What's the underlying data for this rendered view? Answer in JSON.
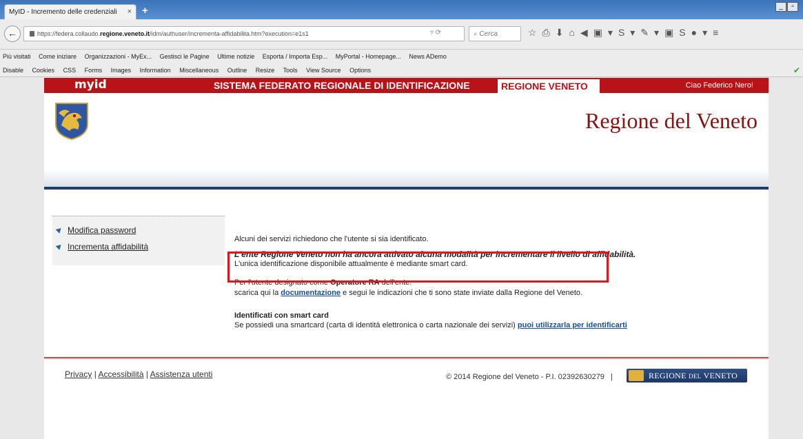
{
  "browser": {
    "tab_title": "MyID - Incremento delle credenziali",
    "tab_close": "×",
    "new_tab": "+",
    "url_prefix": "https://federa.collaudo.",
    "url_host": "regione.veneto.it",
    "url_path": "/idm/authuser/incrementa-affidabilita.htm?execution=e1s1",
    "search_placeholder": "Cerca",
    "bookmarks": [
      "Più visitati",
      "Come iniziare",
      "Organizzazioni - MyEx...",
      "Gestisci le Pagine",
      "Ultime notizie",
      "Esporta / Importa Esp...",
      "MyPortal - Homepage...",
      "News ADemo"
    ],
    "webdev_items": [
      "Disable",
      "Cookies",
      "CSS",
      "Forms",
      "Images",
      "Information",
      "Miscellaneous",
      "Outline",
      "Resize",
      "Tools",
      "View Source",
      "Options"
    ]
  },
  "site": {
    "logo": "myid",
    "system_name": "SISTEMA FEDERATO REGIONALE DI IDENTIFICAZIONE",
    "region_label": "REGIONE VENETO",
    "greeting": "Ciao Federico Nero!",
    "title": "Regione del Veneto"
  },
  "sidebar": {
    "items": [
      {
        "label": "Modifica password"
      },
      {
        "label": "Incrementa affidabilità"
      }
    ]
  },
  "main": {
    "intro": "Alcuni dei servizi richiedono che l'utente si sia identificato.",
    "notice_bold": "L'ente Regione Veneto non ha ancora attivato alcuna modalità per incrementare il livello di affidabilità.",
    "notice_line": "L'unica identificazione disponibile attualmente è mediante smart card.",
    "operator_prefix": "Per l'utente designato come ",
    "operator_role": "Operatore RA",
    "operator_suffix": " dell'ente:",
    "download_prefix": "scarica qui la ",
    "download_link": "documentazione",
    "download_suffix": " e segui le indicazioni che ti sono state inviate dalla Regione del Veneto.",
    "smartcard_heading": "Identificati con smart card",
    "smartcard_text": "Se possiedi una smartcard (carta di identità elettronica o carta nazionale dei servizi) ",
    "smartcard_link": "puoi utilizzarla per identificarti"
  },
  "footer": {
    "privacy": "Privacy",
    "accessibility": "Accessibilità",
    "assistance": "Assistenza utenti",
    "separator": "|",
    "copyright": "© 2014 Regione del Veneto - P.I. 02392630279",
    "logo_text_1": "REGIONE",
    "logo_text_2": "DEL",
    "logo_text_3": "VENETO"
  },
  "colors": {
    "brand_red": "#b9131a",
    "navy": "#1f3b6c",
    "highlight": "#e0161d"
  }
}
